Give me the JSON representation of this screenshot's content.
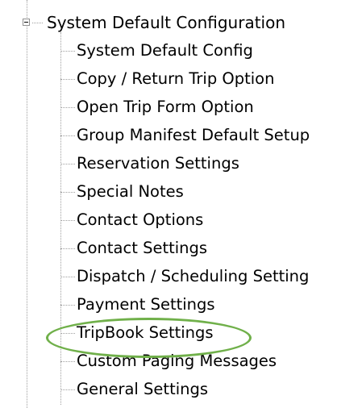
{
  "tree": {
    "root_label": "System Default Configuration",
    "children": [
      "System Default Config",
      "Copy / Return Trip Option",
      "Open Trip Form Option",
      "Group Manifest Default Setup",
      "Reservation Settings",
      "Special Notes",
      "Contact Options",
      "Contact Settings",
      "Dispatch / Scheduling Setting",
      "Payment Settings",
      "TripBook Settings",
      "Custom Paging Messages",
      "General Settings"
    ]
  },
  "highlight": {
    "target": "TripBook Settings",
    "color": "#70b04a"
  }
}
